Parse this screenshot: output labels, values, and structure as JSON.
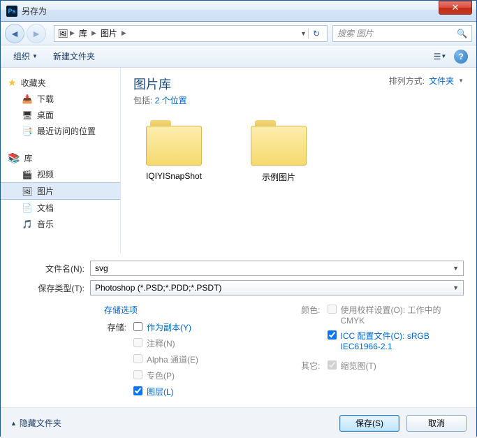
{
  "window": {
    "title": "另存为",
    "app_icon": "Ps"
  },
  "nav": {
    "breadcrumb": [
      "库",
      "图片"
    ],
    "search_placeholder": "搜索 图片"
  },
  "toolbar": {
    "organize": "组织",
    "newfolder": "新建文件夹"
  },
  "sidebar": {
    "favorites": {
      "label": "收藏夹",
      "items": [
        "下载",
        "桌面",
        "最近访问的位置"
      ]
    },
    "library": {
      "label": "库",
      "items": [
        "视频",
        "图片",
        "文档",
        "音乐"
      ]
    }
  },
  "content": {
    "title": "图片库",
    "include_prefix": "包括: ",
    "include_link": "2 个位置",
    "sort_label": "排列方式:",
    "sort_value": "文件夹",
    "folders": [
      "IQIYISnapShot",
      "示例图片"
    ]
  },
  "form": {
    "filename_label": "文件名(N):",
    "filename_value": "svg",
    "filetype_label": "保存类型(T):",
    "filetype_value": "Photoshop (*.PSD;*.PDD;*.PSDT)"
  },
  "options": {
    "store_header": "存储选项",
    "store_label": "存储:",
    "ascopy": "作为副本(Y)",
    "notes": "注释(N)",
    "alpha": "Alpha 通道(E)",
    "spot": "专色(P)",
    "layers": "图层(L)",
    "color_label": "颜色:",
    "proof": "使用校样设置(O): 工作中的 CMYK",
    "icc": "ICC 配置文件(C): sRGB IEC61966-2.1",
    "other_label": "其它:",
    "thumb": "缩览图(T)"
  },
  "footer": {
    "hide_folders": "隐藏文件夹",
    "save": "保存(S)",
    "cancel": "取消"
  }
}
